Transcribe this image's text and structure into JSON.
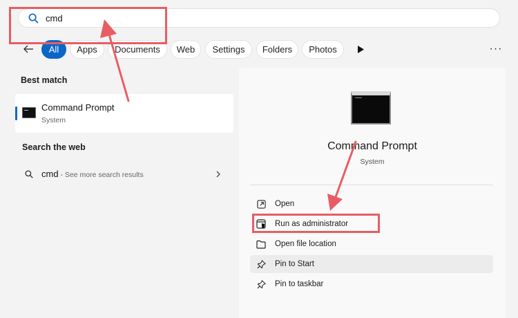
{
  "search": {
    "value": "cmd",
    "icon": "search-icon"
  },
  "filters": {
    "back_icon": "back-arrow-icon",
    "items": [
      {
        "label": "All",
        "active": true
      },
      {
        "label": "Apps"
      },
      {
        "label": "Documents"
      },
      {
        "label": "Web"
      },
      {
        "label": "Settings"
      },
      {
        "label": "Folders"
      },
      {
        "label": "Photos"
      }
    ],
    "more_label": "···"
  },
  "best_match": {
    "heading": "Best match",
    "title": "Command Prompt",
    "subtitle": "System"
  },
  "web": {
    "heading": "Search the web",
    "query": "cmd",
    "suffix": " - See more search results"
  },
  "detail": {
    "title": "Command Prompt",
    "subtitle": "System",
    "actions": [
      {
        "label": "Open",
        "icon": "open-external-icon"
      },
      {
        "label": "Run as administrator",
        "icon": "shield-admin-icon"
      },
      {
        "label": "Open file location",
        "icon": "folder-icon"
      },
      {
        "label": "Pin to Start",
        "icon": "pin-icon"
      },
      {
        "label": "Pin to taskbar",
        "icon": "pin-icon"
      }
    ]
  },
  "colors": {
    "accent": "#0b67c6",
    "annotation": "#e85d64"
  }
}
